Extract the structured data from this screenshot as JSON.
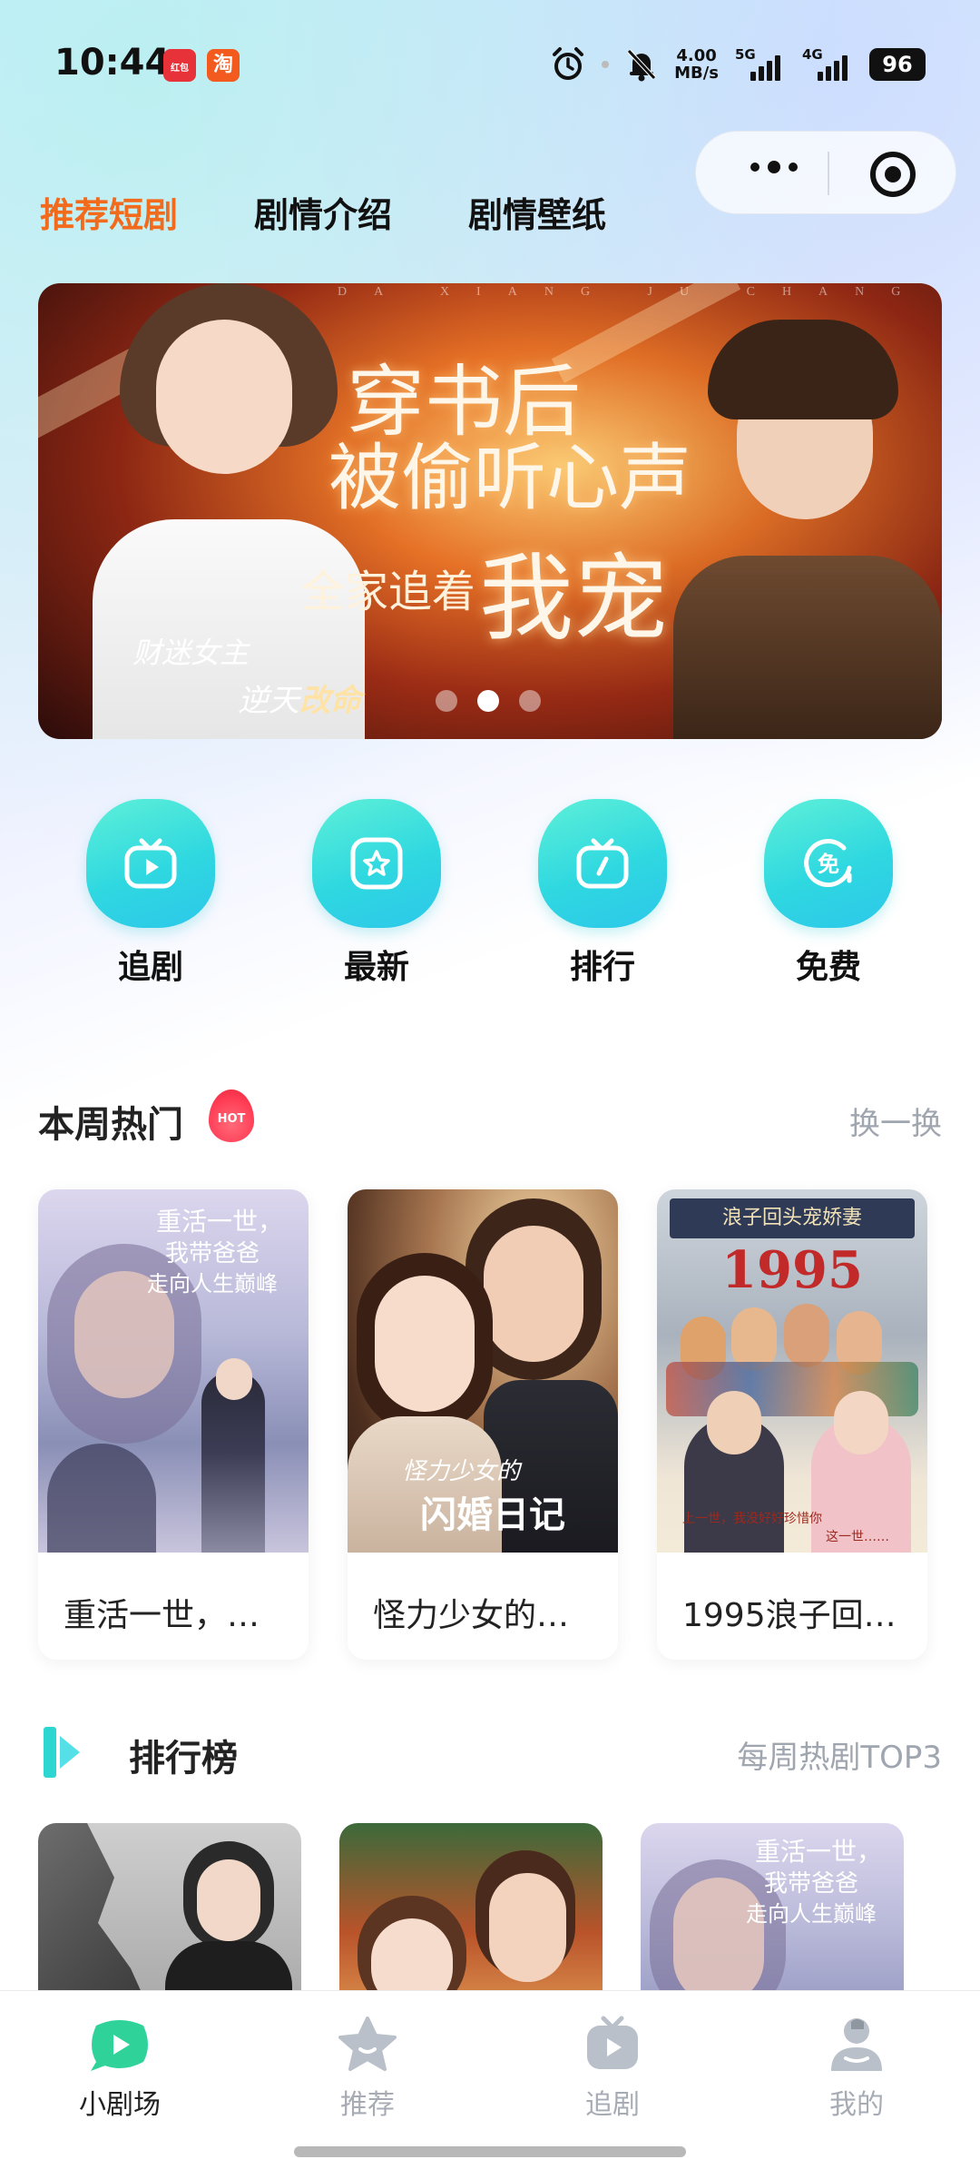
{
  "status_bar": {
    "time": "10:44",
    "app_icons": [
      "红包",
      "淘"
    ],
    "net_speed_value": "4.00",
    "net_speed_unit": "MB/s",
    "signal_1_label": "5G",
    "signal_2_label": "4G",
    "battery": "96"
  },
  "top_tabs": [
    {
      "label": "推荐短剧",
      "active": true
    },
    {
      "label": "剧情介绍",
      "active": false
    },
    {
      "label": "剧情壁纸",
      "active": false
    }
  ],
  "banner": {
    "top_text": "DA XIANG JU CHANG",
    "title_line_1": "穿书后",
    "title_line_2": "被偷听心声",
    "title_line_3a": "全家追着",
    "title_line_3b": "我宠",
    "subtitle_1": "财迷女主",
    "subtitle_2a": "逆天",
    "subtitle_2b": "改命",
    "dots": 3,
    "active_dot": 1
  },
  "quick_menu": [
    {
      "label": "追剧",
      "icon": "tv-play-icon"
    },
    {
      "label": "最新",
      "icon": "star-box-icon"
    },
    {
      "label": "排行",
      "icon": "tv-rank-icon"
    },
    {
      "label": "免费",
      "icon": "free-icon"
    }
  ],
  "hot_section": {
    "title": "本周热门",
    "badge": "HOT",
    "link": "换一换",
    "items": [
      {
        "title": "重活一世，…",
        "poster_text_1": "重活一世，",
        "poster_text_2": "我带爸爸",
        "poster_text_3": "走向人生巅峰"
      },
      {
        "title": "怪力少女的…",
        "poster_text_1": "怪力少女的",
        "poster_text_2": "闪婚日记"
      },
      {
        "title": "1995浪子回…",
        "poster_top": "浪子回头宠娇妻",
        "poster_year": "1995",
        "poster_bottom_1": "上一世，我没好好珍惜你",
        "poster_bottom_2": "这一世……"
      }
    ]
  },
  "rank_section": {
    "title": "排行榜",
    "link": "每周热剧TOP3",
    "items": [
      {
        "poster_text": ""
      },
      {
        "poster_text": ""
      },
      {
        "poster_text_1": "重活一世，",
        "poster_text_2": "我带爸爸",
        "poster_text_3": "走向人生巅峰"
      }
    ]
  },
  "tabbar": [
    {
      "label": "小剧场",
      "icon": "theater-icon",
      "active": true
    },
    {
      "label": "推荐",
      "icon": "star-icon",
      "active": false
    },
    {
      "label": "追剧",
      "icon": "tv-icon",
      "active": false
    },
    {
      "label": "我的",
      "icon": "profile-icon",
      "active": false
    }
  ],
  "colors": {
    "accent": "#f26b1d",
    "teal": "#2fd8e0",
    "muted": "#a0a6b0"
  }
}
